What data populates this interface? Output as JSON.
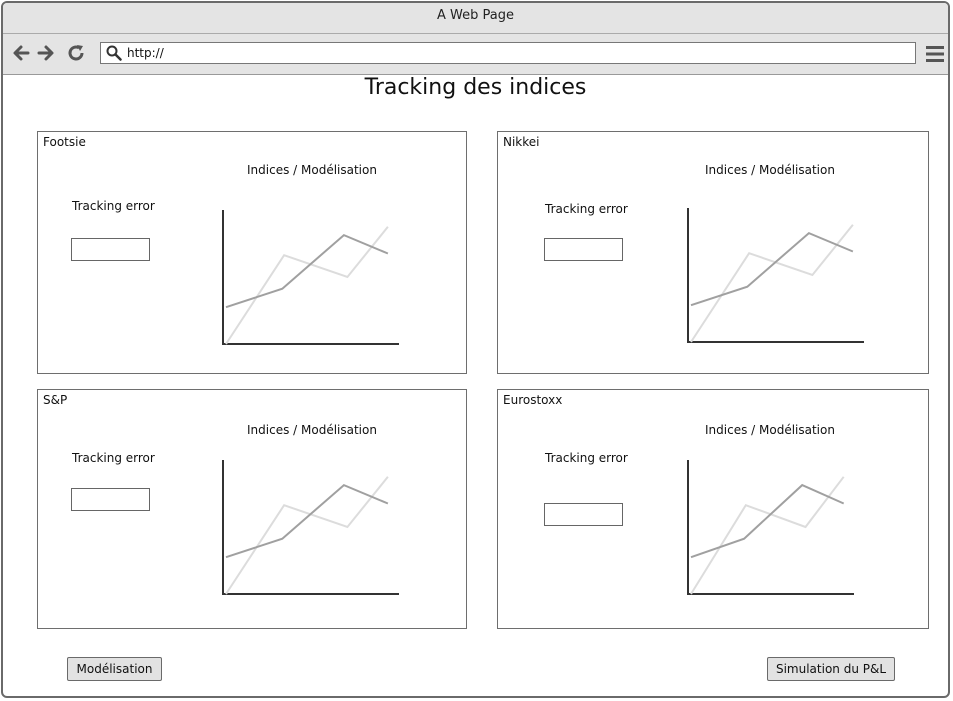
{
  "window": {
    "title": "A Web Page"
  },
  "browser": {
    "url": "http://"
  },
  "page": {
    "title": "Tracking des indices"
  },
  "panels": [
    {
      "name": "Footsie",
      "chart_title": "Indices / Modélisation",
      "tracking_label": "Tracking error",
      "tracking_value": ""
    },
    {
      "name": "Nikkei",
      "chart_title": "Indices / Modélisation",
      "tracking_label": "Tracking error",
      "tracking_value": ""
    },
    {
      "name": "S&P",
      "chart_title": "Indices / Modélisation",
      "tracking_label": "Tracking error",
      "tracking_value": ""
    },
    {
      "name": "Eurostoxx",
      "chart_title": "Indices / Modélisation",
      "tracking_label": "Tracking error",
      "tracking_value": ""
    }
  ],
  "buttons": {
    "modelisation": "Modélisation",
    "simulation": "Simulation du P&L"
  },
  "icons": [
    "back-icon",
    "forward-icon",
    "reload-icon",
    "search-icon",
    "hamburger-menu-icon"
  ],
  "colors": {
    "chrome": "#e4e4e4",
    "series_dark": "#a0a0a0",
    "series_light": "#dcdcdc",
    "axis": "#333333"
  },
  "chart_data": [
    {
      "type": "line",
      "title": "Indices / Modélisation",
      "series": [
        {
          "values": [
            [
              0,
              22
            ],
            [
              0.32,
              33
            ],
            [
              0.67,
              65
            ],
            [
              0.92,
              54
            ]
          ]
        },
        {
          "values": [
            [
              0,
              0
            ],
            [
              0.33,
              53
            ],
            [
              0.69,
              40
            ],
            [
              0.92,
              70
            ]
          ]
        }
      ],
      "grid": false
    },
    {
      "type": "line",
      "title": "Indices / Modélisation",
      "series": [
        {
          "values": [
            [
              0,
              22
            ],
            [
              0.32,
              33
            ],
            [
              0.67,
              65
            ],
            [
              0.92,
              54
            ]
          ]
        },
        {
          "values": [
            [
              0,
              0
            ],
            [
              0.33,
              53
            ],
            [
              0.69,
              40
            ],
            [
              0.92,
              70
            ]
          ]
        }
      ],
      "grid": false
    },
    {
      "type": "line",
      "title": "Indices / Modélisation",
      "series": [
        {
          "values": [
            [
              0,
              22
            ],
            [
              0.32,
              33
            ],
            [
              0.67,
              65
            ],
            [
              0.92,
              54
            ]
          ]
        },
        {
          "values": [
            [
              0,
              0
            ],
            [
              0.33,
              53
            ],
            [
              0.69,
              40
            ],
            [
              0.92,
              70
            ]
          ]
        }
      ],
      "grid": false
    },
    {
      "type": "line",
      "title": "Indices / Modélisation",
      "series": [
        {
          "values": [
            [
              0,
              22
            ],
            [
              0.32,
              33
            ],
            [
              0.67,
              65
            ],
            [
              0.92,
              54
            ]
          ]
        },
        {
          "values": [
            [
              0,
              0
            ],
            [
              0.33,
              53
            ],
            [
              0.69,
              40
            ],
            [
              0.92,
              70
            ]
          ]
        }
      ],
      "grid": false
    }
  ]
}
